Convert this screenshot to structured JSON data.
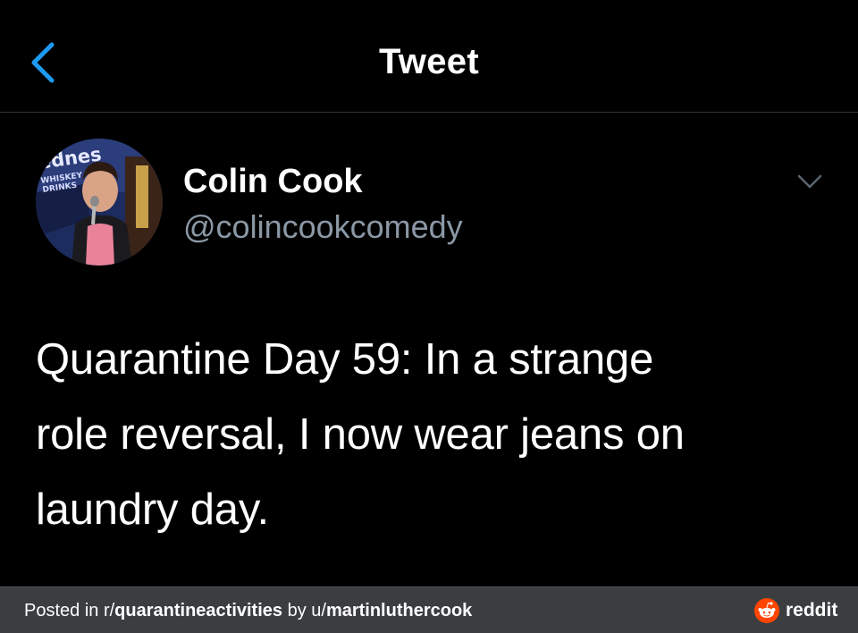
{
  "header": {
    "title": "Tweet",
    "back_icon": "chevron-left-icon"
  },
  "author": {
    "name": "Colin Cook",
    "handle": "@colincookcomedy",
    "avatar_signage": [
      "ednes",
      "WHISKEY",
      "DRINKS"
    ]
  },
  "tweet": {
    "lines": [
      "Quarantine Day 59: In a strange",
      "role reversal, I now wear jeans on",
      "laundry day."
    ]
  },
  "footer": {
    "prefix": "Posted in r/",
    "subreddit": "quarantineactivities",
    "by": " by u/",
    "username": "martinluthercook",
    "brand": "reddit"
  },
  "colors": {
    "background": "#000000",
    "accent": "#1d9bf0",
    "secondary_text": "#8b98a5",
    "footer_bg": "#3b3e41",
    "reddit_orange": "#ff4500"
  }
}
